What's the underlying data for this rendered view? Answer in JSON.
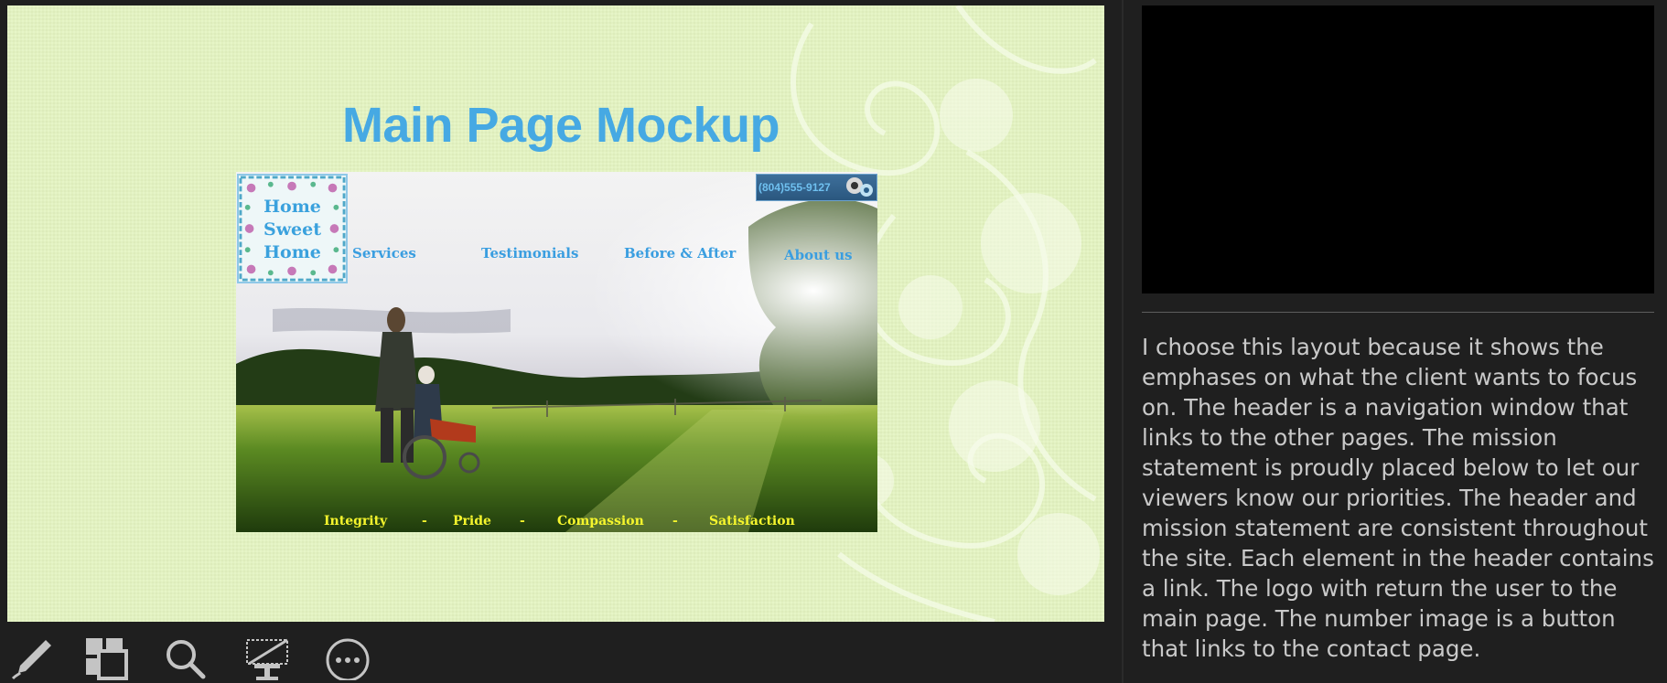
{
  "slide": {
    "title": "Main Page Mockup",
    "background_color": "#e4f4c1",
    "title_color": "#46a9e3"
  },
  "mockup": {
    "logo": {
      "line1": "Home",
      "line2": "Sweet",
      "line3": "Home"
    },
    "phone": "(804)555-9127",
    "nav": {
      "services": "Services",
      "testimonials": "Testimonials",
      "before_after": "Before & After",
      "about": "About us"
    },
    "mission": {
      "integrity": "Integrity",
      "sep1": "-",
      "pride": "Pride",
      "sep2": "-",
      "compassion": "Compassion",
      "sep3": "-",
      "satisfaction": "Satisfaction"
    },
    "nav_color": "#3a9ee0",
    "mission_color": "#f5f52d"
  },
  "toolbar": {
    "tools": [
      "pen-icon",
      "slides-grid-icon",
      "zoom-icon",
      "subtitles-icon",
      "more-options-icon"
    ]
  },
  "notes": {
    "text": "I choose this layout because it shows the emphases on what the client wants to focus on. The header is a navigation window that links to the other pages. The mission statement is proudly placed below to let our viewers know our priorities. The header and mission statement are consistent throughout the site. Each element in the header contains a link. The logo with return the user to the main page. The number image is a button that links to the contact page."
  }
}
